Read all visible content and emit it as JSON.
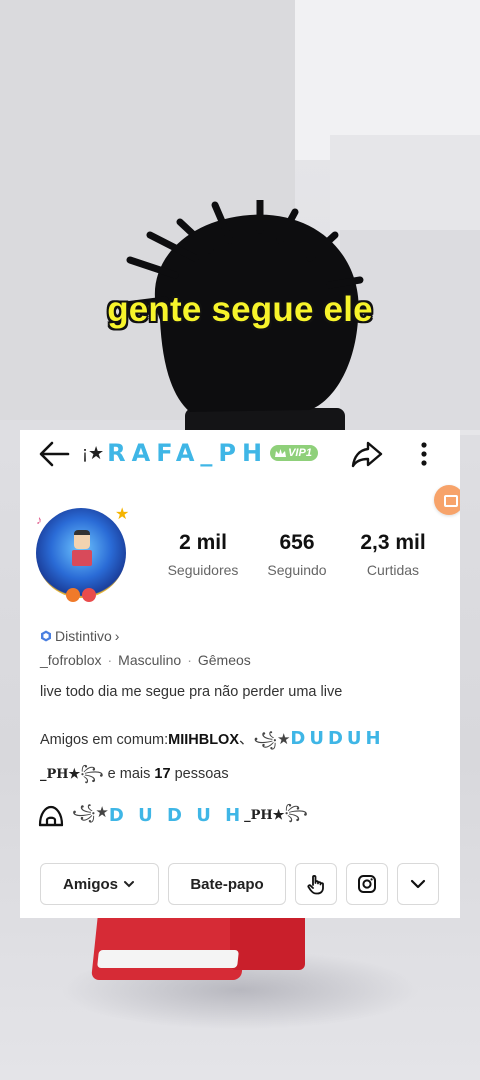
{
  "caption": "gente segue ele",
  "profile": {
    "name_prefix": "¡★",
    "name": "RAFA_PH",
    "vip_badge": "VIP1"
  },
  "stats": [
    {
      "value": "2 mil",
      "label": "Seguidores"
    },
    {
      "value": "656",
      "label": "Seguindo"
    },
    {
      "value": "2,3 mil",
      "label": "Curtidas"
    }
  ],
  "badge": {
    "label": "Distintivo",
    "chevron": "›"
  },
  "tags": [
    "_fofroblox",
    "Masculino",
    "Gêmeos"
  ],
  "tag_separator": "·",
  "bio": "live todo dia me segue pra não perder uma live",
  "mutual_friends": {
    "prefix": "Amigos em comum:",
    "friend_1": "MIIHBLOX",
    "separator": "、",
    "friend_2_sym": "꧁★",
    "friend_2_name": "DUDUH",
    "friend_2_suffix": "_PH★",
    "friend_2_end": "꧂",
    "more_text_a": " e mais ",
    "more_count": "17",
    "more_text_b": " pessoas"
  },
  "family": {
    "sym": "꧁★",
    "name": "D U D U H",
    "suffix": "_PH★",
    "end": "꧂"
  },
  "buttons": {
    "friends": "Amigos",
    "chat": "Bate-papo"
  },
  "icons": {
    "back": "arrow-left-icon",
    "share": "share-icon",
    "more": "more-vertical-icon",
    "badge": "hexagon-icon",
    "family": "igloo-icon",
    "friends_dropdown": "chevron-down-icon",
    "poke": "hand-tap-icon",
    "instagram": "instagram-icon",
    "expand": "chevron-down-icon"
  },
  "colors": {
    "caption": "#f7f42b",
    "name": "#3fb6e6",
    "vip": "#8fd07a",
    "badge_icon": "#4a7fe0"
  }
}
